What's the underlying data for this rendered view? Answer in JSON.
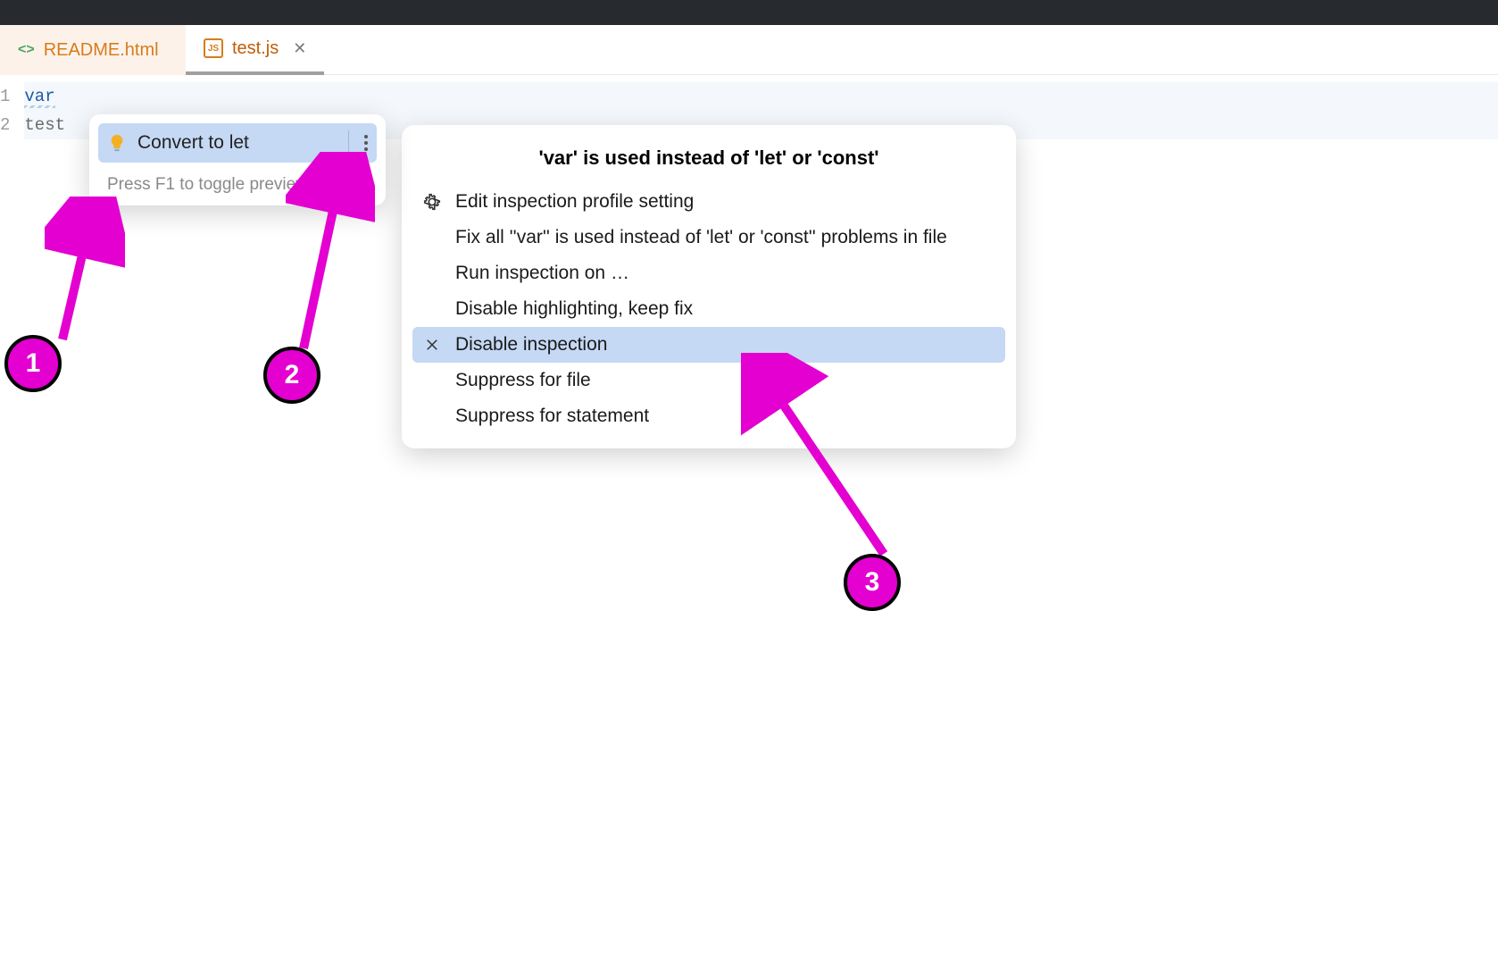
{
  "tabs": {
    "readme": {
      "label": "README.html"
    },
    "active": {
      "label": "test.js"
    }
  },
  "gutter": {
    "line1": "1",
    "line2": "2"
  },
  "code": {
    "keyword": "var",
    "identifier": " test"
  },
  "intention": {
    "action": "Convert to let",
    "hint": "Press F1 to toggle preview"
  },
  "submenu": {
    "title": "'var' is used instead of 'let' or 'const'",
    "items": [
      {
        "label": "Edit inspection profile setting",
        "icon": "gear"
      },
      {
        "label": "Fix all ''var'' is used instead of 'let' or 'const'' problems in file",
        "icon": ""
      },
      {
        "label": "Run inspection on …",
        "icon": ""
      },
      {
        "label": "Disable highlighting, keep fix",
        "icon": ""
      },
      {
        "label": "Disable inspection",
        "icon": "x",
        "selected": true
      },
      {
        "label": "Suppress for file",
        "icon": ""
      },
      {
        "label": "Suppress for statement",
        "icon": ""
      }
    ]
  },
  "annotations": {
    "n1": "1",
    "n2": "2",
    "n3": "3"
  }
}
